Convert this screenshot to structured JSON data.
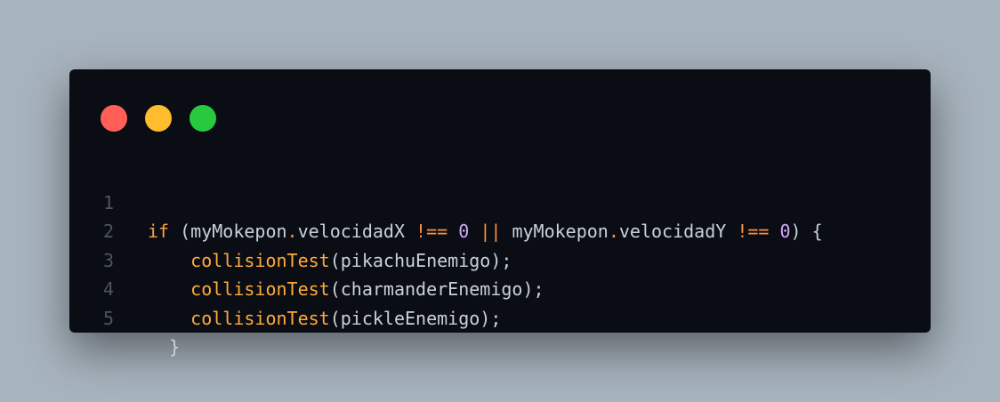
{
  "window": {
    "controls": [
      "close",
      "minimize",
      "maximize"
    ]
  },
  "code": {
    "lines": [
      {
        "number": "1",
        "tokens": [
          {
            "t": "if",
            "c": "kw"
          },
          {
            "t": " (myMokepon",
            "c": "plain"
          },
          {
            "t": ".",
            "c": "op"
          },
          {
            "t": "velocidadX ",
            "c": "plain"
          },
          {
            "t": "!==",
            "c": "op"
          },
          {
            "t": " ",
            "c": "plain"
          },
          {
            "t": "0",
            "c": "num"
          },
          {
            "t": " ",
            "c": "plain"
          },
          {
            "t": "||",
            "c": "op"
          },
          {
            "t": " myMokepon",
            "c": "plain"
          },
          {
            "t": ".",
            "c": "op"
          },
          {
            "t": "velocidadY ",
            "c": "plain"
          },
          {
            "t": "!==",
            "c": "op"
          },
          {
            "t": " ",
            "c": "plain"
          },
          {
            "t": "0",
            "c": "num"
          },
          {
            "t": ") {",
            "c": "plain"
          }
        ]
      },
      {
        "number": "2",
        "tokens": [
          {
            "t": "    ",
            "c": "plain"
          },
          {
            "t": "collisionTest",
            "c": "fn"
          },
          {
            "t": "(pikachuEnemigo);",
            "c": "plain"
          }
        ]
      },
      {
        "number": "3",
        "tokens": [
          {
            "t": "    ",
            "c": "plain"
          },
          {
            "t": "collisionTest",
            "c": "fn"
          },
          {
            "t": "(charmanderEnemigo);",
            "c": "plain"
          }
        ]
      },
      {
        "number": "4",
        "tokens": [
          {
            "t": "    ",
            "c": "plain"
          },
          {
            "t": "collisionTest",
            "c": "fn"
          },
          {
            "t": "(pickleEnemigo);",
            "c": "plain"
          }
        ]
      },
      {
        "number": "5",
        "tokens": [
          {
            "t": "  }",
            "c": "plain"
          }
        ]
      }
    ]
  }
}
